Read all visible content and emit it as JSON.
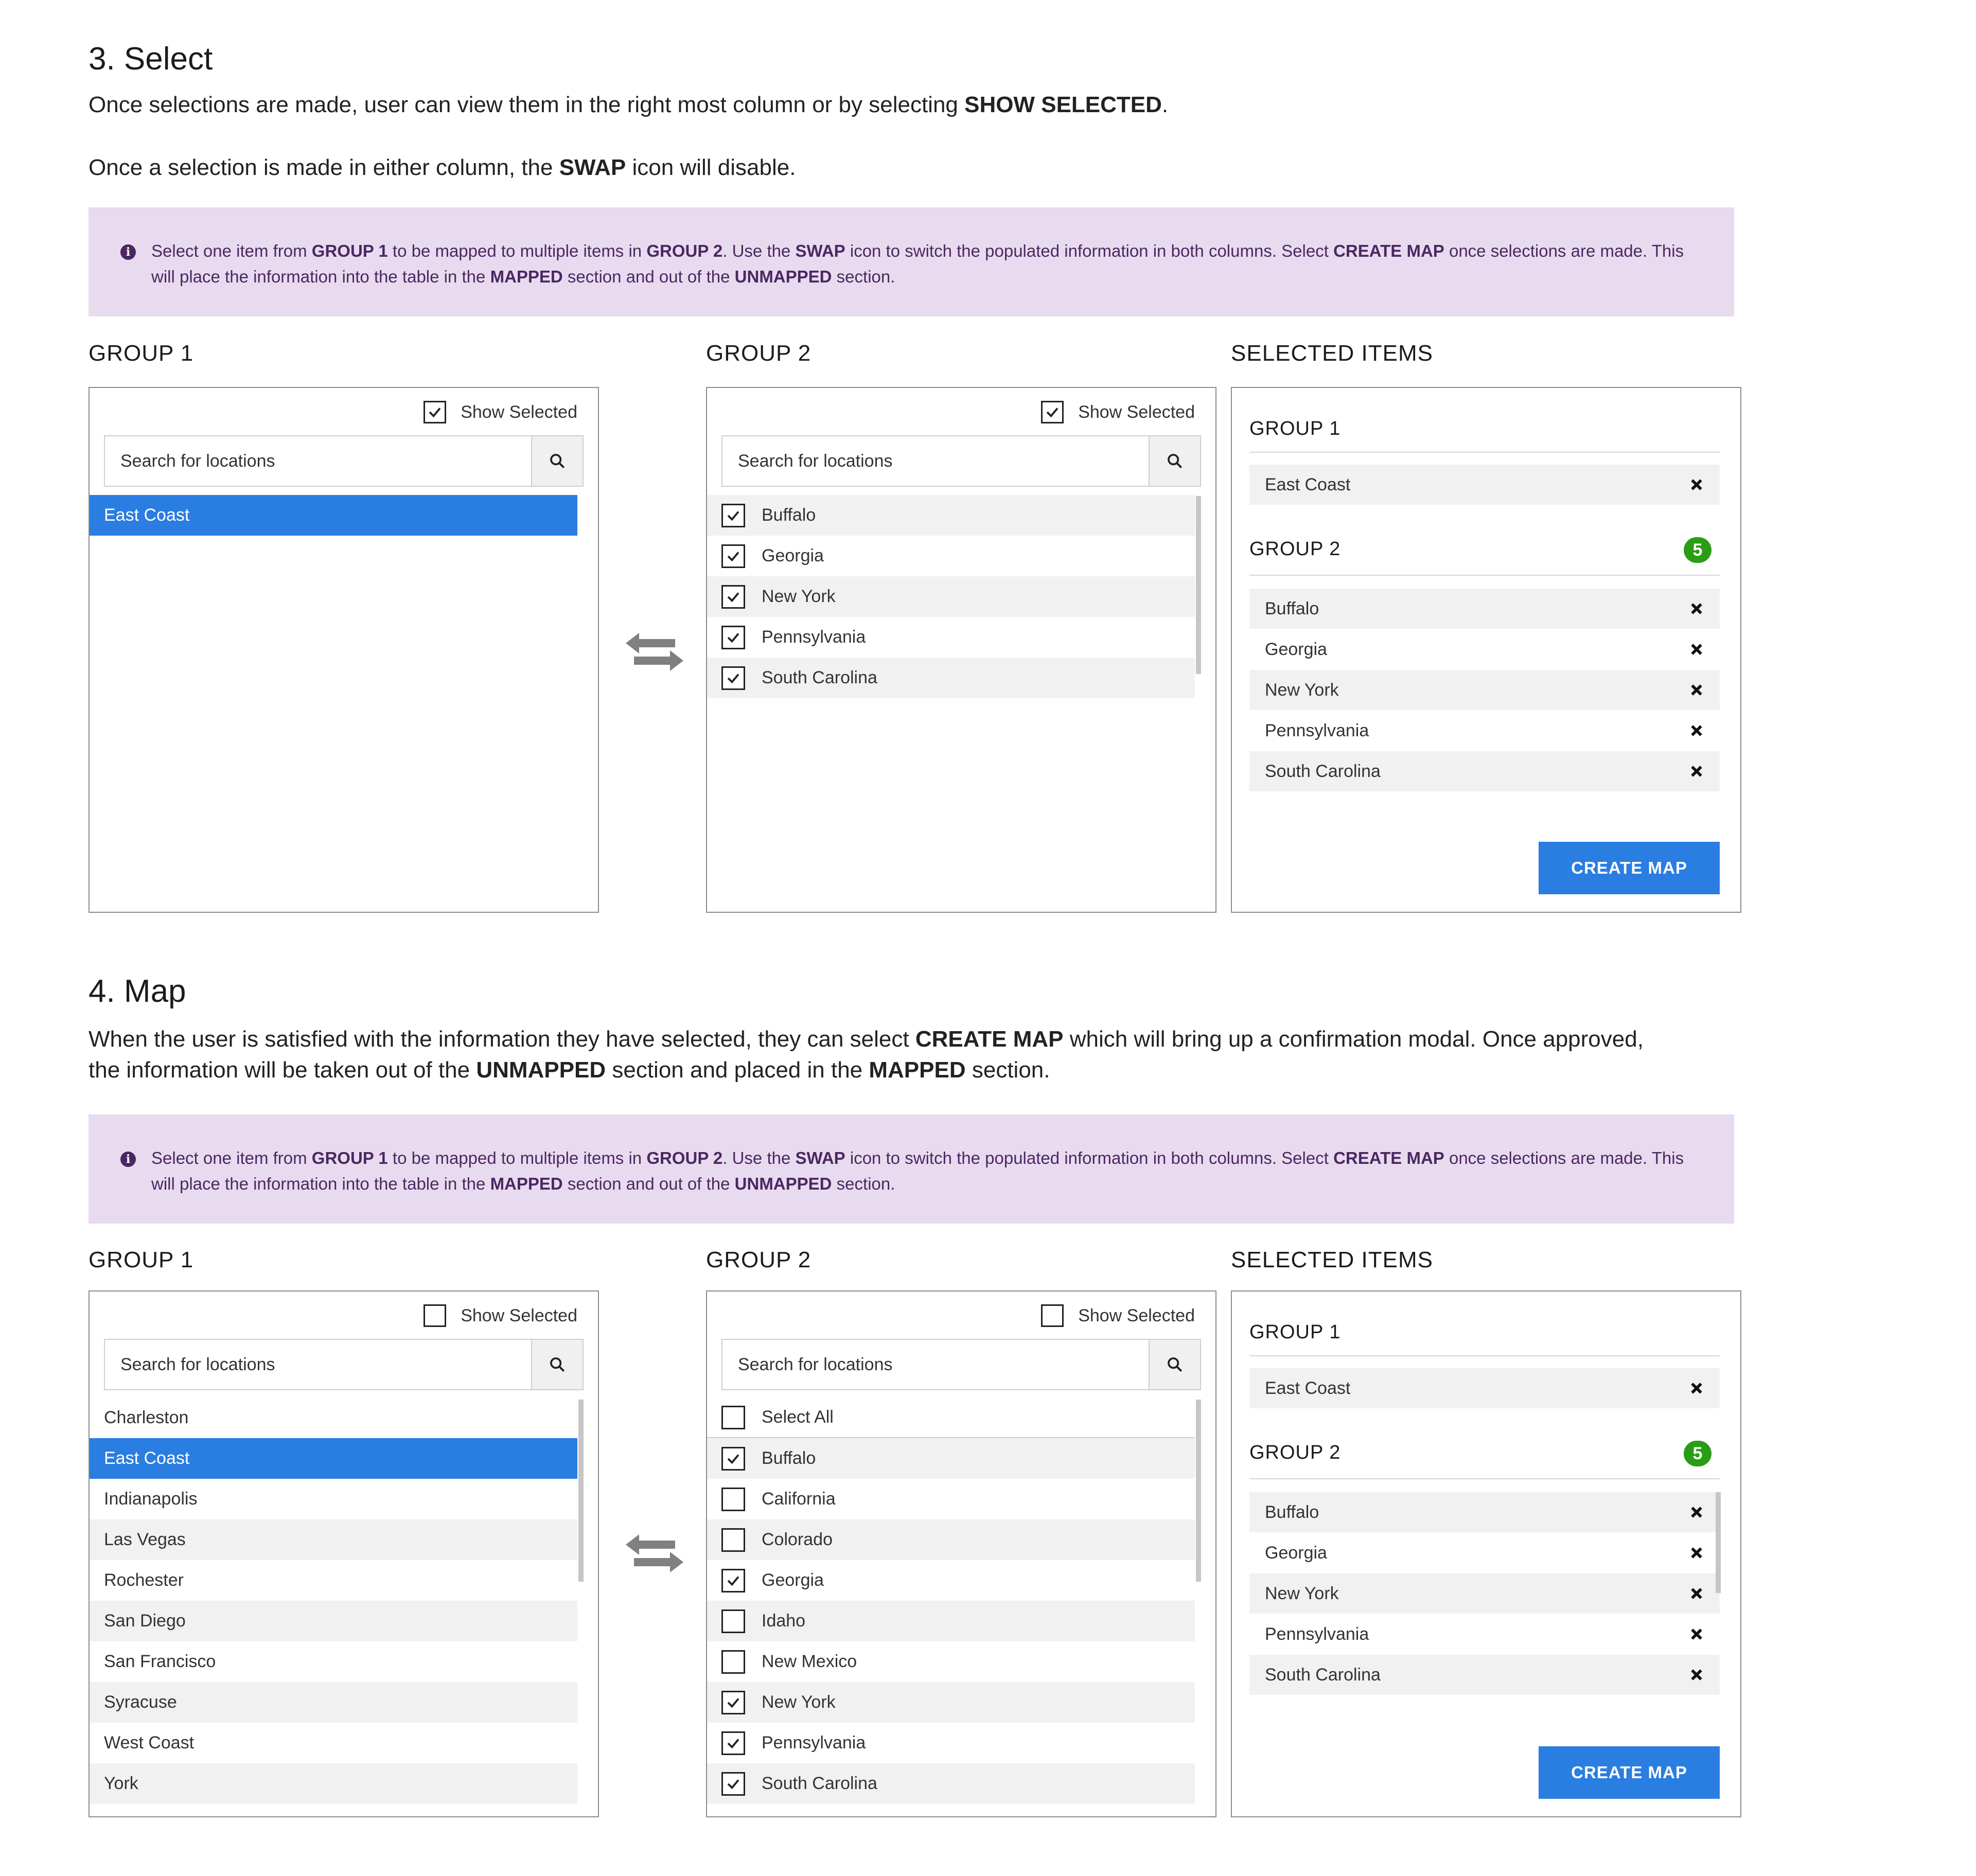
{
  "colors": {
    "primary": "#2a7de1",
    "notice_bg": "#e8dbef",
    "notice_text": "#4b2761",
    "badge": "#2a9d16"
  },
  "sec3": {
    "title": "3. Select",
    "p1_a": "Once selections are made, user can view them in the right most column or by selecting ",
    "p1_b": "SHOW SELECTED",
    "p1_c": ".",
    "p2_a": "Once a selection is made in either column, the ",
    "p2_b": "SWAP",
    "p2_c": " icon will disable."
  },
  "sec4": {
    "title": "4. Map",
    "p1_a": "When the user is satisfied with the information they have selected, they can select ",
    "p1_b": "CREATE MAP",
    "p1_c": " which will bring up a confirmation modal. Once approved,",
    "p2_a": "the information will be taken out of the ",
    "p2_b": "UNMAPPED",
    "p2_c": " section and placed in the ",
    "p2_d": "MAPPED",
    "p2_e": " section."
  },
  "notice": {
    "t1": "Select one item from ",
    "b1": "GROUP 1",
    "t2": " to be mapped to multiple items in ",
    "b2": "GROUP 2",
    "t3": ". Use the ",
    "b3": "SWAP",
    "t4": " icon to switch the populated information in both columns. Select ",
    "b4": "CREATE MAP",
    "t5": " once selections are made. This will place the information into the table in the ",
    "b5": "MAPPED",
    "t6": " section and out of the ",
    "b6": "UNMAPPED",
    "t7": " section."
  },
  "labels": {
    "group1": "GROUP 1",
    "group2": "GROUP 2",
    "selected_items": "SELECTED ITEMS",
    "show_selected": "Show Selected",
    "search_placeholder": "Search for locations",
    "create_map": "CREATE MAP",
    "select_all": "Select All",
    "group2_count": "5"
  },
  "sel3": {
    "group1_items": [
      "East Coast"
    ],
    "group2_items": [
      "Buffalo",
      "Georgia",
      "New York",
      "Pennsylvania",
      "South Carolina"
    ]
  },
  "map4": {
    "group1_items": [
      "Charleston",
      "East Coast",
      "Indianapolis",
      "Las Vegas",
      "Rochester",
      "San Diego",
      "San Francisco",
      "Syracuse",
      "West Coast",
      "York"
    ],
    "group2_items": [
      "Buffalo",
      "California",
      "Colorado",
      "Georgia",
      "Idaho",
      "New Mexico",
      "New York",
      "Pennsylvania",
      "South Carolina"
    ]
  },
  "selected_summary": {
    "group1": [
      "East Coast"
    ],
    "group2": [
      "Buffalo",
      "Georgia",
      "New York",
      "Pennsylvania",
      "South Carolina"
    ]
  }
}
